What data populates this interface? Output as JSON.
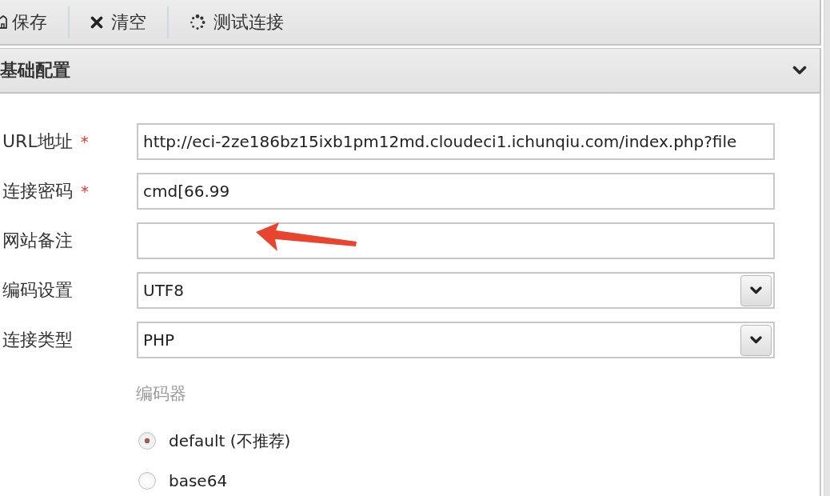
{
  "toolbar": {
    "buttons": [
      {
        "kind": "save",
        "label": "保存"
      },
      {
        "kind": "clear",
        "label": "清空"
      },
      {
        "kind": "test",
        "label": "测试连接"
      }
    ]
  },
  "panel": {
    "title": "基础配置",
    "expanded": true,
    "fields": [
      {
        "kind": "text",
        "label": "URL地址",
        "required_mark": "*",
        "value": "http://eci-2ze186bz15ixb1pm12md.cloudeci1.ichunqiu.com/index.php?file"
      },
      {
        "kind": "text",
        "label": "连接密码",
        "required_mark": "*",
        "value": "cmd[66.99"
      },
      {
        "kind": "text",
        "label": "网站备注"
      },
      {
        "kind": "select",
        "label": "编码设置",
        "value": "UTF8"
      },
      {
        "kind": "select",
        "label": "连接类型",
        "value": "PHP"
      }
    ],
    "encoder": {
      "title": "编码器",
      "options": [
        {
          "label": "default (不推荐)",
          "selected": true
        },
        {
          "label": "base64",
          "selected": false
        }
      ]
    }
  }
}
